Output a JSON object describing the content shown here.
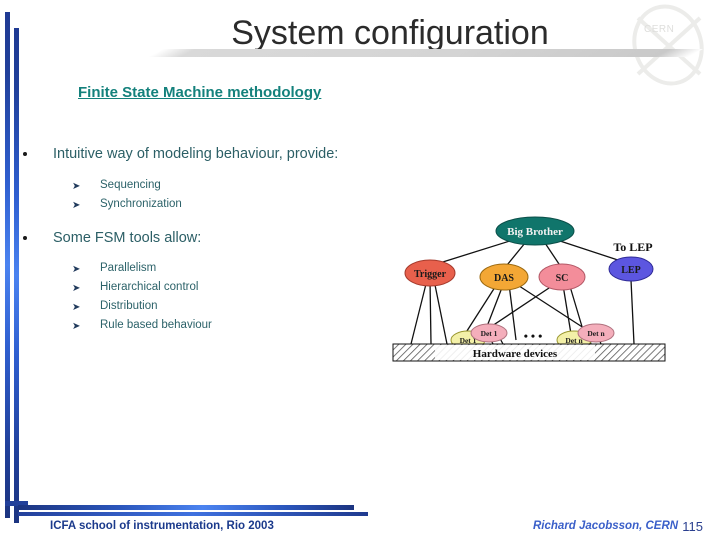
{
  "slide": {
    "title": "System configuration",
    "subtitle": "Finite State Machine methodology",
    "logo_text": "CERN",
    "accent_blue": "#1f3a93",
    "accent_teal": "#14817c",
    "body_text_color": "#2c5f66"
  },
  "content": {
    "bullets": [
      {
        "label": "Intuitive way of modeling behaviour, provide:",
        "children": [
          "Sequencing",
          "Synchronization"
        ]
      },
      {
        "label": "Some FSM tools allow:",
        "children": [
          "Parallelism",
          "Hierarchical control",
          "Distribution",
          "Rule based behaviour"
        ]
      }
    ],
    "sub_bullet_glyph": "➤"
  },
  "diagram": {
    "caption": "Hardware devices",
    "external_label": "To LEP",
    "ellipsis": "•  •  •",
    "nodes": [
      {
        "id": "big-brother",
        "label": "Big Brother",
        "fill": "#10756b",
        "text": "#f2f2f2"
      },
      {
        "id": "trigger",
        "label": "Trigger",
        "fill": "#e8604c",
        "text": "#1a1a1a"
      },
      {
        "id": "das",
        "label": "DAS",
        "fill": "#f3a735",
        "text": "#1a1a1a"
      },
      {
        "id": "sc",
        "label": "SC",
        "fill": "#f38d9a",
        "text": "#1a1a1a"
      },
      {
        "id": "lep",
        "label": "LEP",
        "fill": "#5c56e0",
        "text": "#1a1a1a"
      },
      {
        "id": "det-1-yellow",
        "label": "Det 1",
        "fill": "#f3f0a8",
        "text": "#1a1a1a"
      },
      {
        "id": "det-1-pink",
        "label": "Det 1",
        "fill": "#f4aebb",
        "text": "#1a1a1a"
      },
      {
        "id": "det-n-yellow",
        "label": "Det n",
        "fill": "#f3f0a8",
        "text": "#1a1a1a"
      },
      {
        "id": "det-n-pink",
        "label": "Det n",
        "fill": "#f4aebb",
        "text": "#1a1a1a"
      }
    ]
  },
  "footer": {
    "left": "ICFA school of instrumentation, Rio 2003",
    "author": "Richard Jacobsson, CERN",
    "page_number": "115"
  }
}
